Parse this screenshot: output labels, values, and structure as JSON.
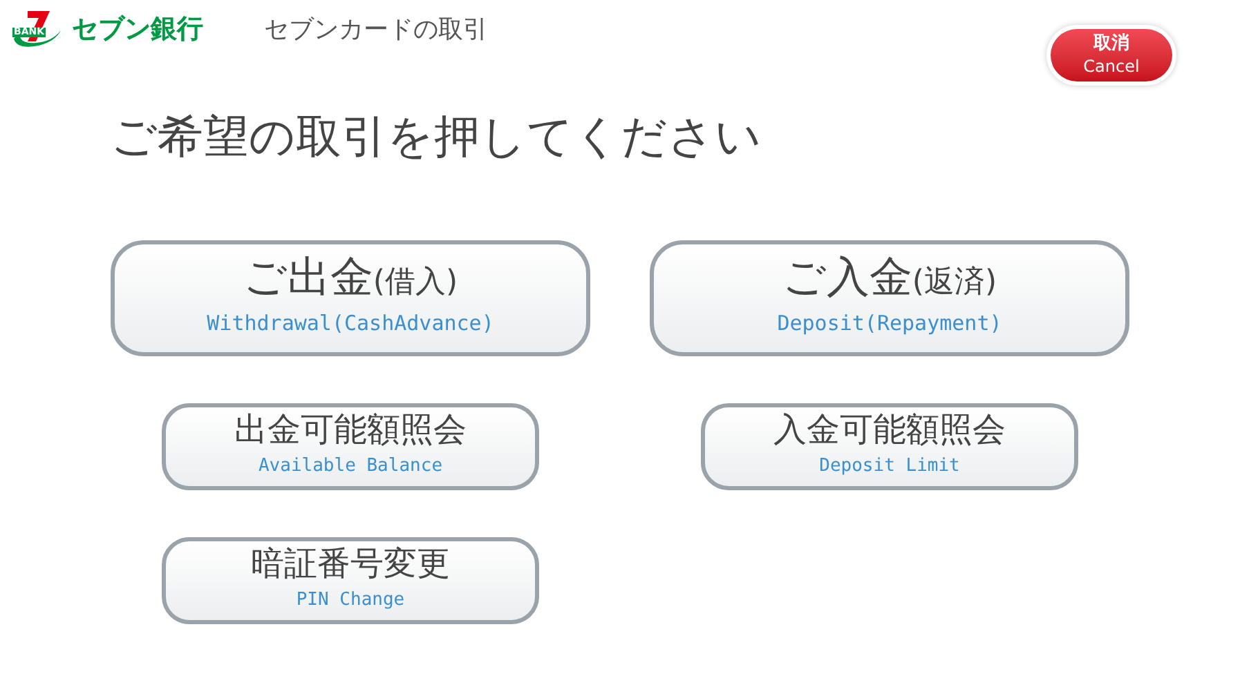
{
  "header": {
    "logo_badge": "BANK",
    "logo_text": "セブン銀行",
    "title": "セブンカードの取引"
  },
  "cancel_button": {
    "label": "取消",
    "sublabel": "Cancel"
  },
  "prompt": "ご希望の取引を押してください",
  "options": [
    {
      "kind": "large",
      "label": "ご出金",
      "note": "(借入)",
      "sublabel": "Withdrawal(CashAdvance)"
    },
    {
      "kind": "large",
      "label": "ご入金",
      "note": "(返済)",
      "sublabel": "Deposit(Repayment)"
    },
    {
      "kind": "small",
      "label": "出金可能額照会",
      "sublabel": "Available Balance"
    },
    {
      "kind": "small",
      "label": "入金可能額照会",
      "sublabel": "Deposit Limit"
    },
    {
      "kind": "small",
      "label": "暗証番号変更",
      "sublabel": "PIN Change"
    }
  ]
}
